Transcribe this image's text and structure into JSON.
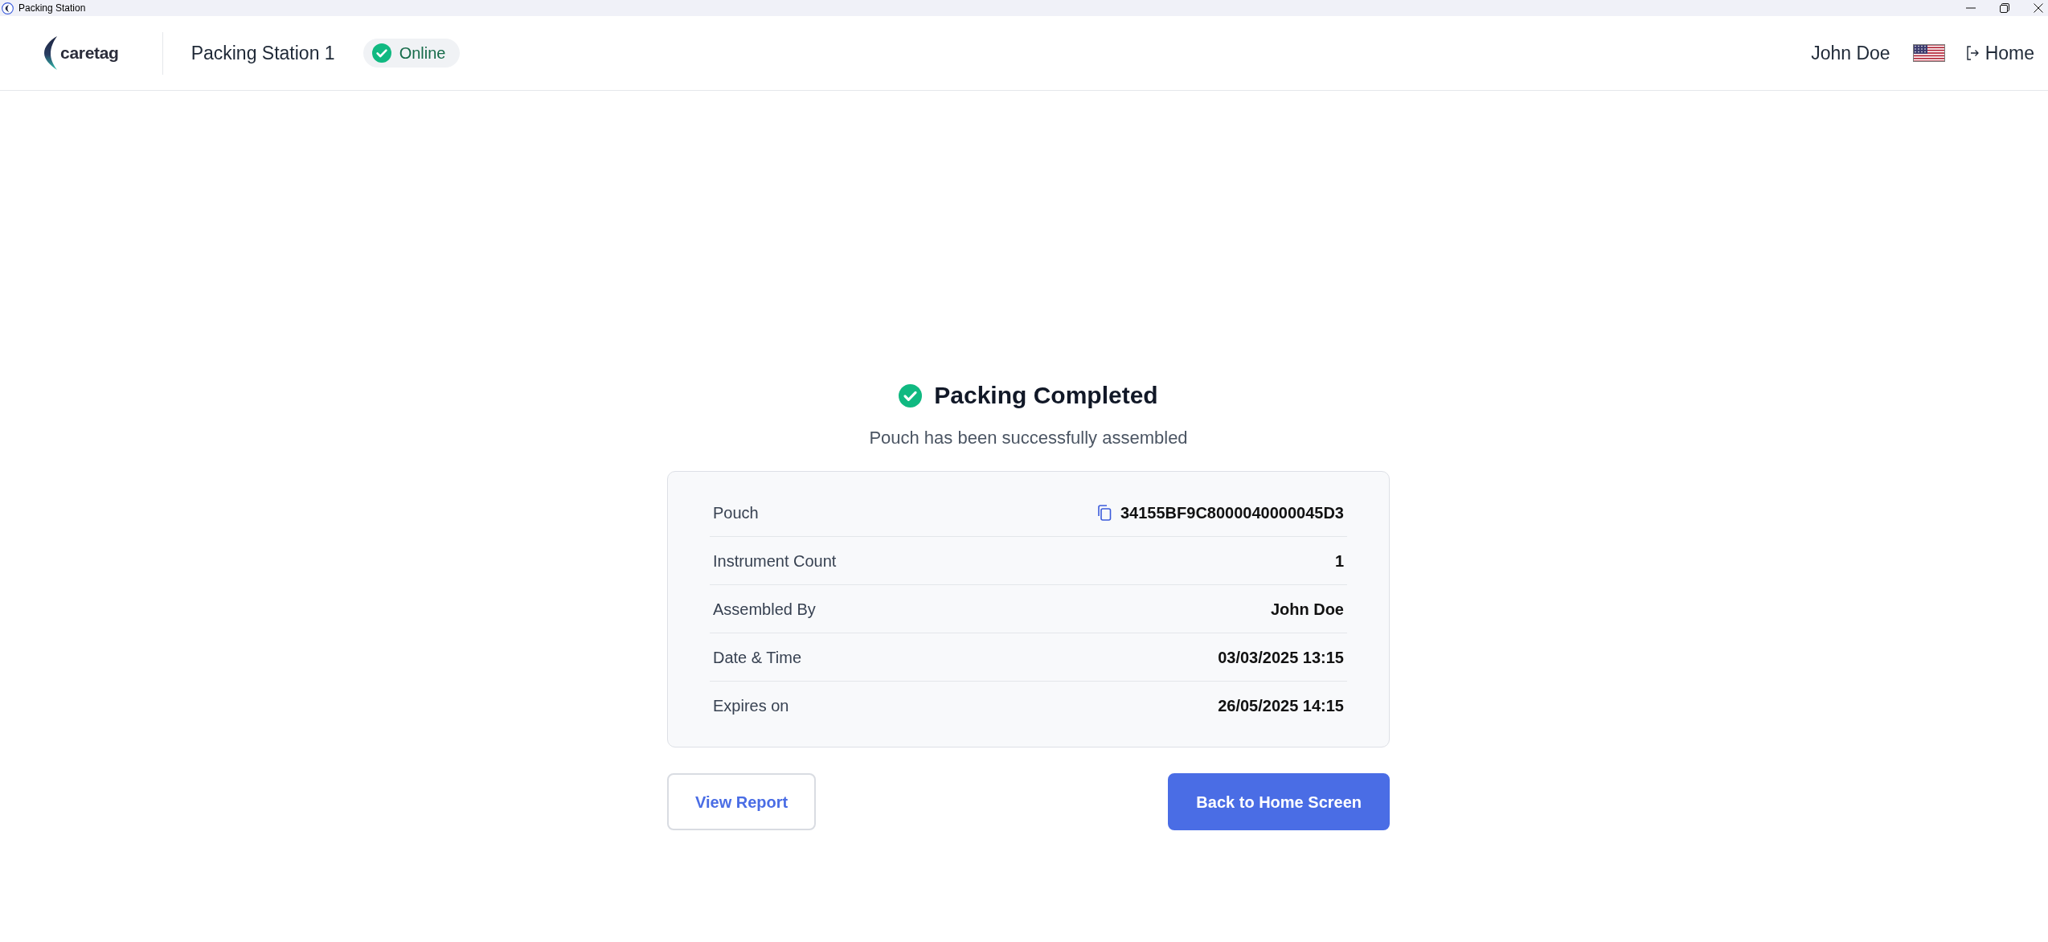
{
  "window": {
    "title": "Packing Station"
  },
  "header": {
    "logo_text": "caretag",
    "station": "Packing Station 1",
    "status": {
      "label": "Online",
      "online": true
    },
    "user": "John Doe",
    "home_link": "Home"
  },
  "result": {
    "title": "Packing Completed",
    "subtitle": "Pouch has been successfully assembled",
    "details": [
      {
        "label": "Pouch",
        "value": "34155BF9C8000040000045D3",
        "copyable": true
      },
      {
        "label": "Instrument Count",
        "value": "1",
        "copyable": false
      },
      {
        "label": "Assembled By",
        "value": "John Doe",
        "copyable": false
      },
      {
        "label": "Date & Time",
        "value": "03/03/2025 13:15",
        "copyable": false
      },
      {
        "label": "Expires on",
        "value": "26/05/2025 14:15",
        "copyable": false
      }
    ],
    "buttons": [
      {
        "label": "View Report",
        "kind": "secondary"
      },
      {
        "label": "Back to Home Screen",
        "kind": "primary"
      }
    ]
  }
}
